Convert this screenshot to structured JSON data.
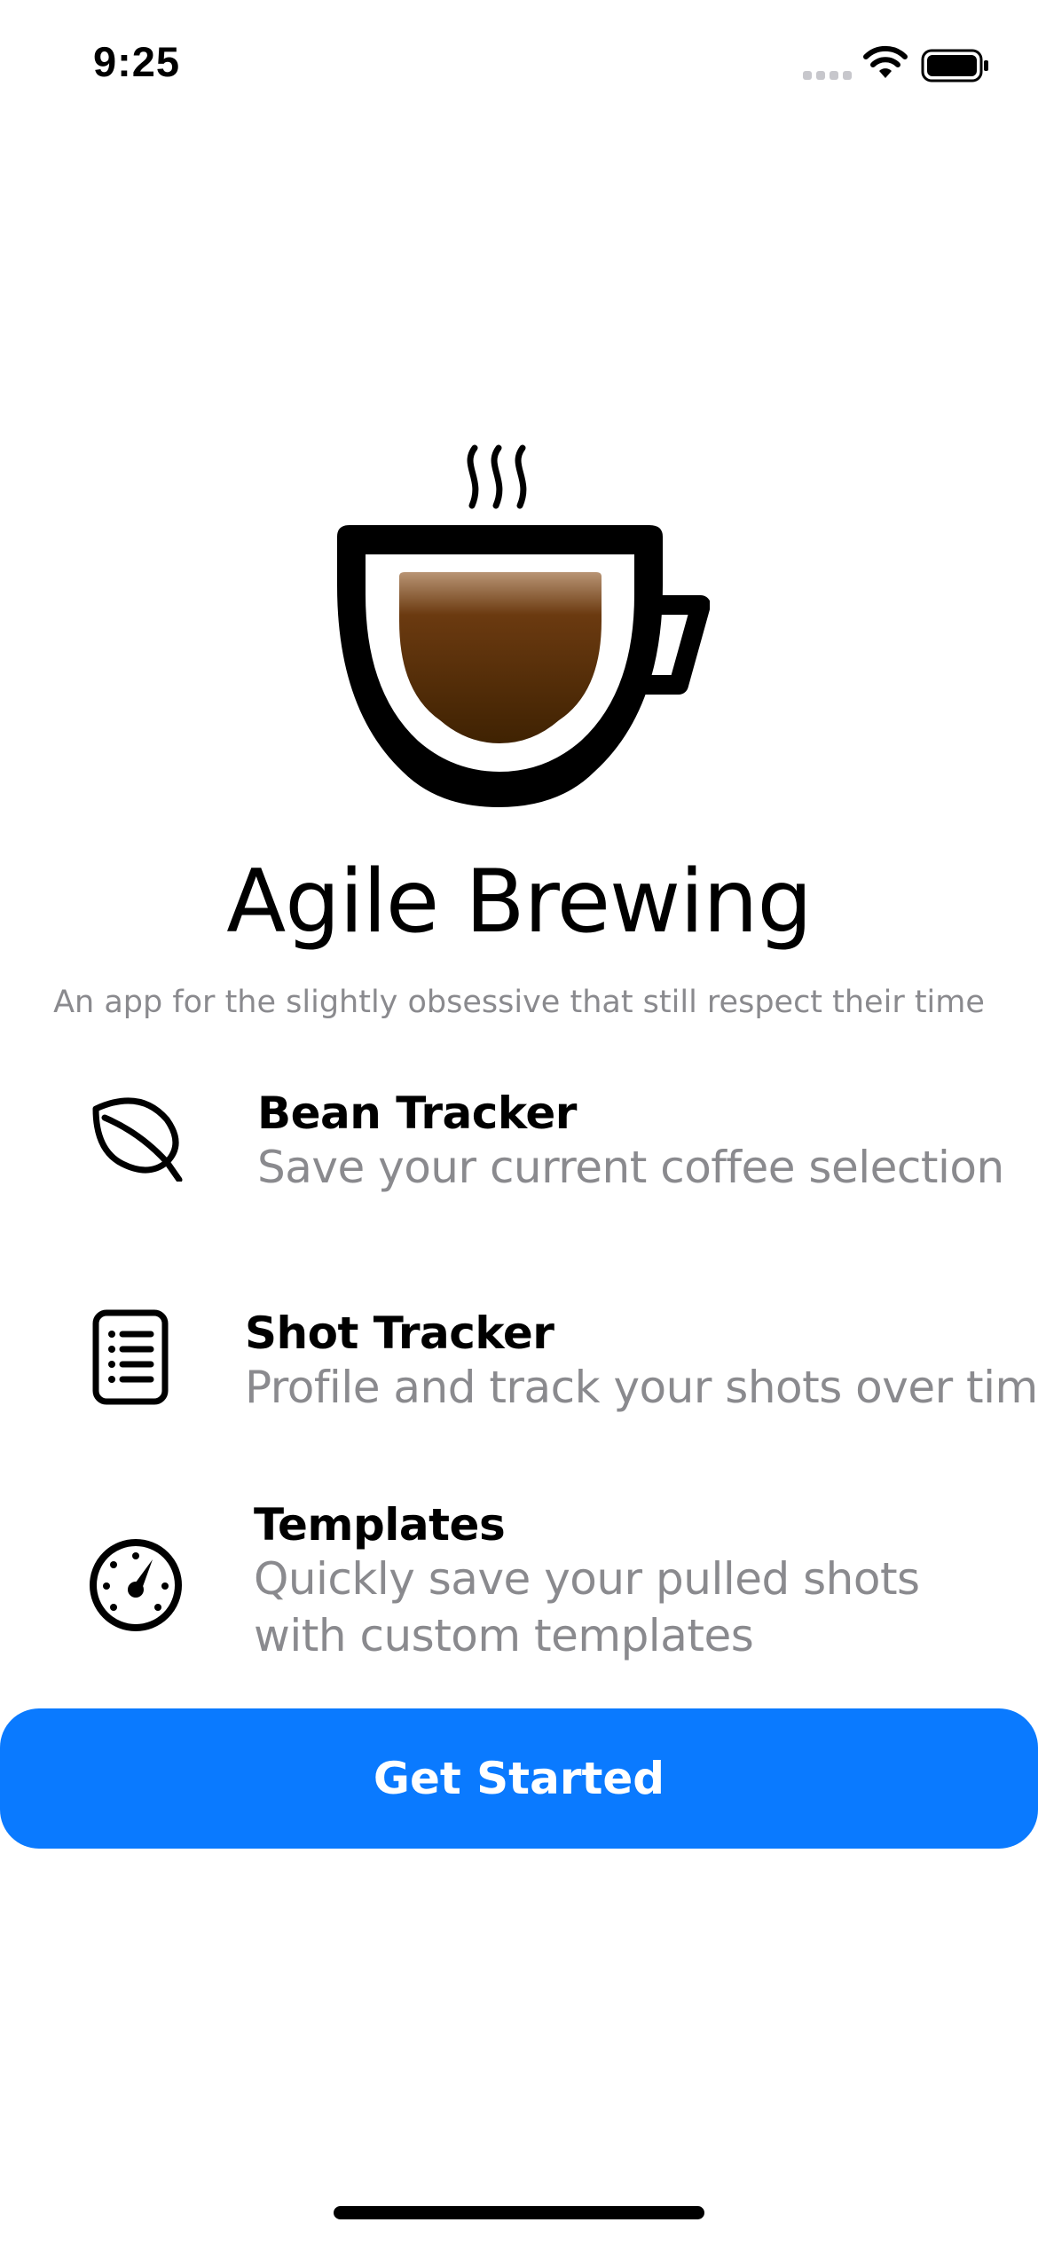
{
  "status_bar": {
    "time": "9:25",
    "icons": [
      "signal-icon",
      "wifi-icon",
      "battery-icon"
    ]
  },
  "hero": {
    "icon": "coffee-cup-icon",
    "title": "Agile Brewing",
    "subtitle": "An app for the slightly obsessive that still respect their time"
  },
  "features": [
    {
      "icon": "leaf-icon",
      "title": "Bean Tracker",
      "description": "Save your current coffee selection"
    },
    {
      "icon": "list-document-icon",
      "title": "Shot Tracker",
      "description": "Profile and track your shots over time"
    },
    {
      "icon": "gauge-icon",
      "title": "Templates",
      "description": "Quickly save your pulled shots with custom templates"
    }
  ],
  "actions": {
    "get_started_label": "Get Started"
  },
  "colors": {
    "accent": "#0a7aff",
    "secondary_text": "#8a8a8e",
    "coffee_top": "#b89474",
    "coffee_bottom": "#3f2202"
  }
}
